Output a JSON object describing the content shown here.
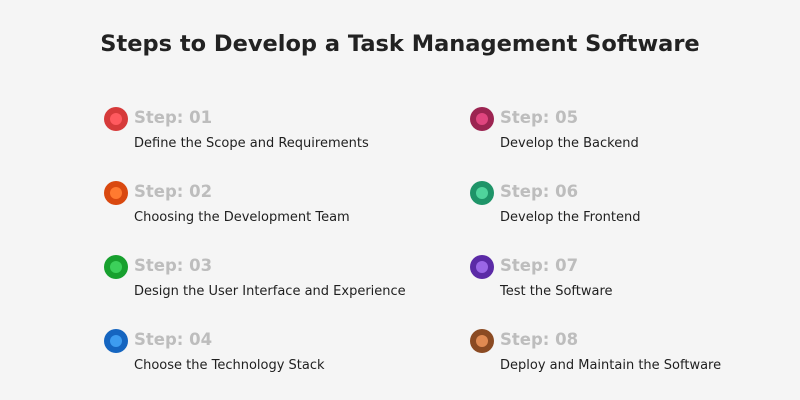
{
  "title": "Steps to Develop a Task Management Software",
  "steps": [
    {
      "label": "Step: 01",
      "desc": "Define the Scope and Requirements",
      "outer": "#d63a3a",
      "inner": "#ff5a5f"
    },
    {
      "label": "Step: 02",
      "desc": "Choosing the Development Team",
      "outer": "#d9480f",
      "inner": "#ff7a30"
    },
    {
      "label": "Step: 03",
      "desc": "Design the User Interface and Experience",
      "outer": "#17a02e",
      "inner": "#3cd05a"
    },
    {
      "label": "Step: 04",
      "desc": "Choose the Technology Stack",
      "outer": "#1565c0",
      "inner": "#3d9cf0"
    },
    {
      "label": "Step: 05",
      "desc": "Develop the Backend",
      "outer": "#9c2451",
      "inner": "#e0457f"
    },
    {
      "label": "Step: 06",
      "desc": "Develop the Frontend",
      "outer": "#1e9468",
      "inner": "#4fd49c"
    },
    {
      "label": "Step: 07",
      "desc": "Test the Software",
      "outer": "#5b2aa6",
      "inner": "#9a66e6"
    },
    {
      "label": "Step: 08",
      "desc": "Deploy and Maintain the Software",
      "outer": "#8b4a22",
      "inner": "#e08a52"
    }
  ]
}
